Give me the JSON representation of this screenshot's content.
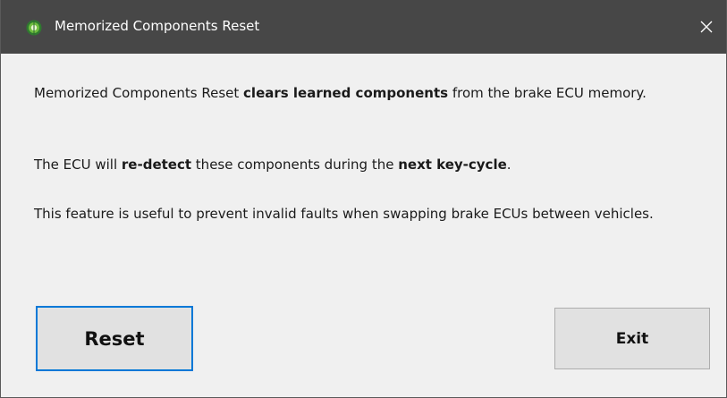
{
  "window": {
    "title": "Memorized Components Reset",
    "close_glyph": "✕",
    "icon": "app-globe-icon"
  },
  "message": {
    "p1_a": "Memorized Components Reset ",
    "p1_b": "clears learned components",
    "p1_c": " from the brake ECU memory.",
    "p2_a": "The ECU will ",
    "p2_b": "re-detect",
    "p2_c": " these components during the ",
    "p2_d": "next key-cycle",
    "p2_e": ".",
    "p3": "This feature is useful to prevent invalid faults when swapping brake ECUs between vehicles."
  },
  "buttons": {
    "reset_label": "Reset",
    "exit_label": "Exit"
  },
  "colors": {
    "titlebar": "#474747",
    "dialog_bg": "#f0f0f0",
    "focus_border": "#0078d7",
    "button_bg": "#e1e1e1"
  }
}
